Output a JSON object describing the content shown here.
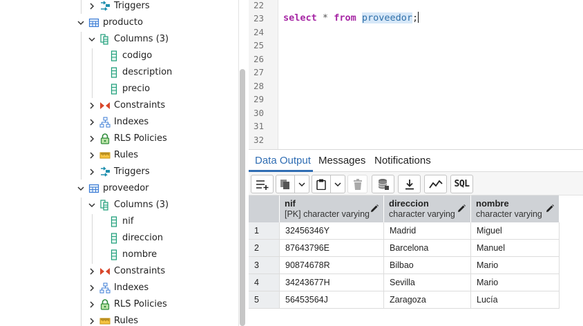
{
  "tree": {
    "nodes": [
      {
        "label": "Triggers",
        "icon": "trigger-icon"
      },
      {
        "label": "producto",
        "icon": "table-icon"
      },
      {
        "label": "Columns (3)",
        "icon": "columns-icon"
      },
      {
        "label": "codigo",
        "icon": "column-icon"
      },
      {
        "label": "description",
        "icon": "column-icon"
      },
      {
        "label": "precio",
        "icon": "column-icon"
      },
      {
        "label": "Constraints",
        "icon": "constraints-icon"
      },
      {
        "label": "Indexes",
        "icon": "indexes-icon"
      },
      {
        "label": "RLS Policies",
        "icon": "rls-policy-icon"
      },
      {
        "label": "Rules",
        "icon": "rules-icon"
      },
      {
        "label": "Triggers",
        "icon": "trigger-icon"
      },
      {
        "label": "proveedor",
        "icon": "table-icon"
      },
      {
        "label": "Columns (3)",
        "icon": "columns-icon"
      },
      {
        "label": "nif",
        "icon": "column-icon"
      },
      {
        "label": "direccion",
        "icon": "column-icon"
      },
      {
        "label": "nombre",
        "icon": "column-icon"
      },
      {
        "label": "Constraints",
        "icon": "constraints-icon"
      },
      {
        "label": "Indexes",
        "icon": "indexes-icon"
      },
      {
        "label": "RLS Policies",
        "icon": "rls-policy-icon"
      },
      {
        "label": "Rules",
        "icon": "rules-icon"
      }
    ]
  },
  "editor": {
    "line_numbers": [
      "22",
      "23",
      "24",
      "25",
      "26",
      "27",
      "28",
      "29",
      "30",
      "31",
      "32"
    ],
    "code": {
      "kw1": "select",
      "op": "*",
      "kw2": "from",
      "ident": "proveedor",
      "punct": ";"
    }
  },
  "output": {
    "tabs": [
      "Data Output",
      "Messages",
      "Notifications"
    ],
    "toolbar": {
      "sql_label": "SQL"
    },
    "columns": [
      {
        "name": "nif",
        "type": "[PK] character varying"
      },
      {
        "name": "direccion",
        "type": "character varying"
      },
      {
        "name": "nombre",
        "type": "character varying"
      }
    ],
    "rows": [
      {
        "num": "1",
        "cells": [
          "32456346Y",
          "Madrid",
          "Miguel"
        ]
      },
      {
        "num": "2",
        "cells": [
          "87643796E",
          "Barcelona",
          "Manuel"
        ]
      },
      {
        "num": "3",
        "cells": [
          "90874678R",
          "Bilbao",
          "Mario"
        ]
      },
      {
        "num": "4",
        "cells": [
          "34243677H",
          "Sevilla",
          "Mario"
        ]
      },
      {
        "num": "5",
        "cells": [
          "56453564J",
          "Zaragoza",
          "Lucía"
        ]
      }
    ]
  },
  "colors": {
    "accent": "#2f6db3",
    "keyword": "#a626a4",
    "identifier": "#2e6fa9",
    "column-icon": "#1e9e7a",
    "constraints-icon": "#d9472b",
    "rls-icon": "#2e8b3a",
    "rules-icon": "#e0a81c",
    "indexes-icon": "#3a7bd5"
  }
}
